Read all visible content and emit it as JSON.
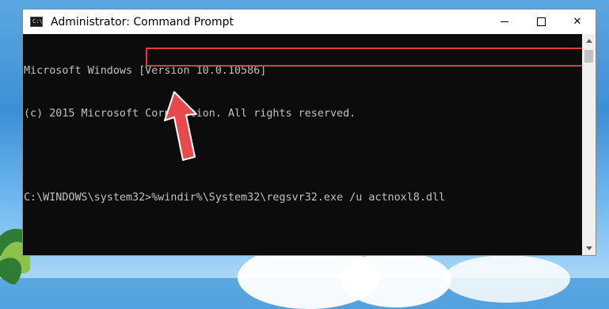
{
  "window": {
    "title": "Administrator: Command Prompt",
    "icon_label": "C:\\.",
    "controls": {
      "minimize": "minimize-icon",
      "maximize": "maximize-icon",
      "close": "✕"
    }
  },
  "console": {
    "lines": [
      "Microsoft Windows [Version 10.0.10586]",
      "(c) 2015 Microsoft Corporotion. All rights reserved."
    ],
    "prompt": "C:\\WINDOWS\\system32>",
    "command": "%windir%\\System32\\regsvr32.exe /u actnoxl8.dll"
  },
  "annotation": {
    "highlight_color": "#e03c3c",
    "arrow_color": "#e8494a"
  },
  "colors": {
    "console_bg": "#0c0c0c",
    "console_fg": "#c0c0c0",
    "titlebar_bg": "#ffffff"
  }
}
